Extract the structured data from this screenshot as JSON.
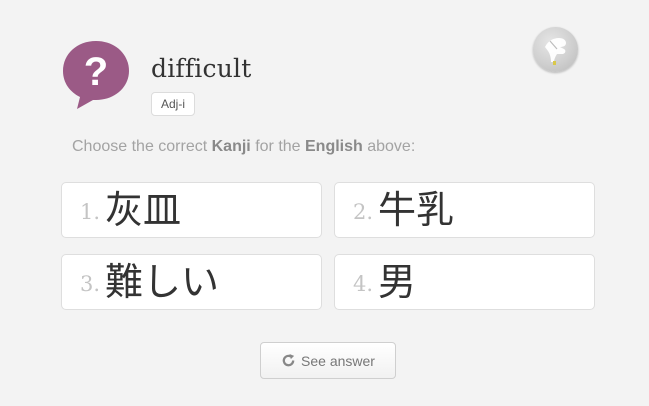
{
  "word": {
    "english": "difficult",
    "part_of_speech": "Adj-i"
  },
  "instructions": {
    "part1": "Choose the correct ",
    "term1": "Kanji",
    "part2": " for the ",
    "term2": "English",
    "part3": " above:"
  },
  "choices": [
    {
      "number": "1.",
      "kanji": "灰皿"
    },
    {
      "number": "2.",
      "kanji": "牛乳"
    },
    {
      "number": "3.",
      "kanji": "難しい"
    },
    {
      "number": "4.",
      "kanji": "男"
    }
  ],
  "actions": {
    "see_answer_label": "See answer"
  },
  "icons": {
    "question": "question-bubble-icon",
    "hint": "hint-hand-icon",
    "refresh": "refresh-icon"
  },
  "colors": {
    "question_bubble": "#9b5a86",
    "text_primary": "#333333",
    "text_muted": "#a3a3a3",
    "background": "#f3f3f3"
  }
}
